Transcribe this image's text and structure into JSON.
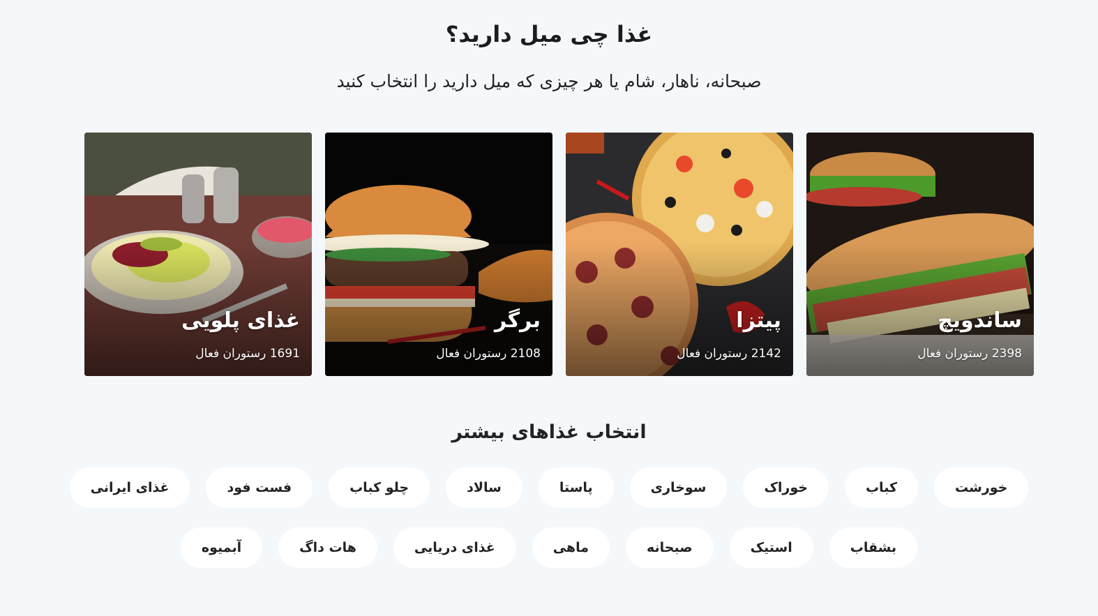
{
  "header": {
    "title": "غذا چی میل دارید؟",
    "subtitle": "صبحانه، ناهار، شام یا هر چیزی که میل دارید را انتخاب کنید"
  },
  "cards": [
    {
      "title": "ساندویچ",
      "meta": "2398 رستوران فعال",
      "icon": "sandwich-photo"
    },
    {
      "title": "پیتزا",
      "meta": "2142 رستوران فعال",
      "icon": "pizza-photo"
    },
    {
      "title": "برگر",
      "meta": "2108 رستوران فعال",
      "icon": "burger-photo"
    },
    {
      "title": "غذای پلویی",
      "meta": "1691 رستوران فعال",
      "icon": "rice-dish-photo"
    }
  ],
  "more": {
    "title": "انتخاب غذاهای بیشتر",
    "row1": [
      "خورشت",
      "کباب",
      "خوراک",
      "سوخاری",
      "پاستا",
      "سالاد",
      "چلو کباب",
      "فست فود",
      "غذای ایرانی"
    ],
    "row2": [
      "بشقاب",
      "استیک",
      "صبحانه",
      "ماهی",
      "غذای دریایی",
      "هات داگ",
      "آبمیوه"
    ]
  },
  "colors": {
    "background": "#f5f8fb",
    "chip": "#ffffff",
    "text": "#1f1f1f"
  }
}
